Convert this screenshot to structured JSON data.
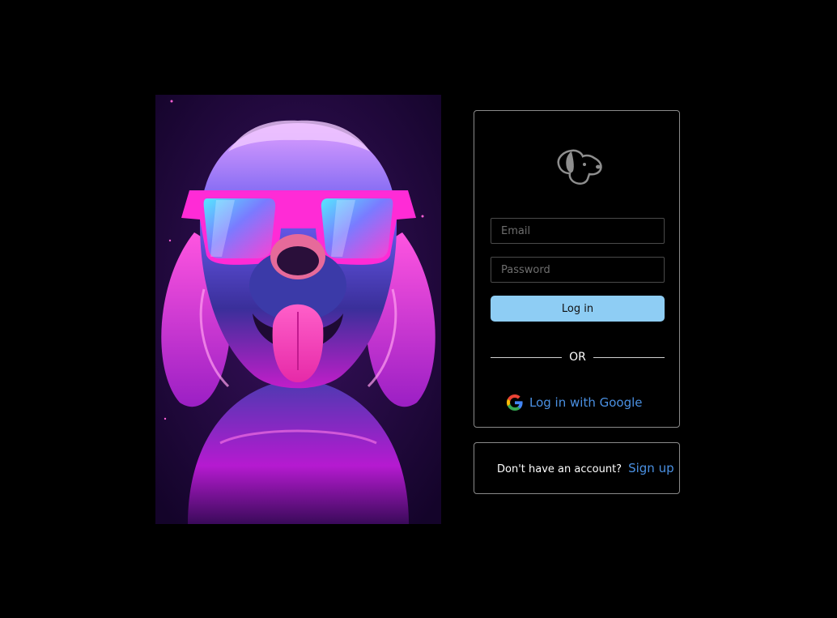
{
  "hero": {
    "image_description_icon": "neon-dog-with-sunglasses-illustration"
  },
  "login": {
    "logo_icon": "dog-head-logo-icon",
    "email_placeholder": "Email",
    "email_value": "",
    "password_placeholder": "Password",
    "password_value": "",
    "login_label": "Log in",
    "divider_text": "OR",
    "google_icon": "google-g-icon",
    "google_label": "Log in with Google"
  },
  "signup": {
    "prompt": "Don't have an account?",
    "link_label": "Sign up"
  },
  "colors": {
    "background": "#000000",
    "card_border": "#8a8a8a",
    "primary_button": "#8ecdf4",
    "link": "#4a90e2",
    "neon_pink": "#ff2bd6",
    "neon_blue": "#4a6cff"
  }
}
